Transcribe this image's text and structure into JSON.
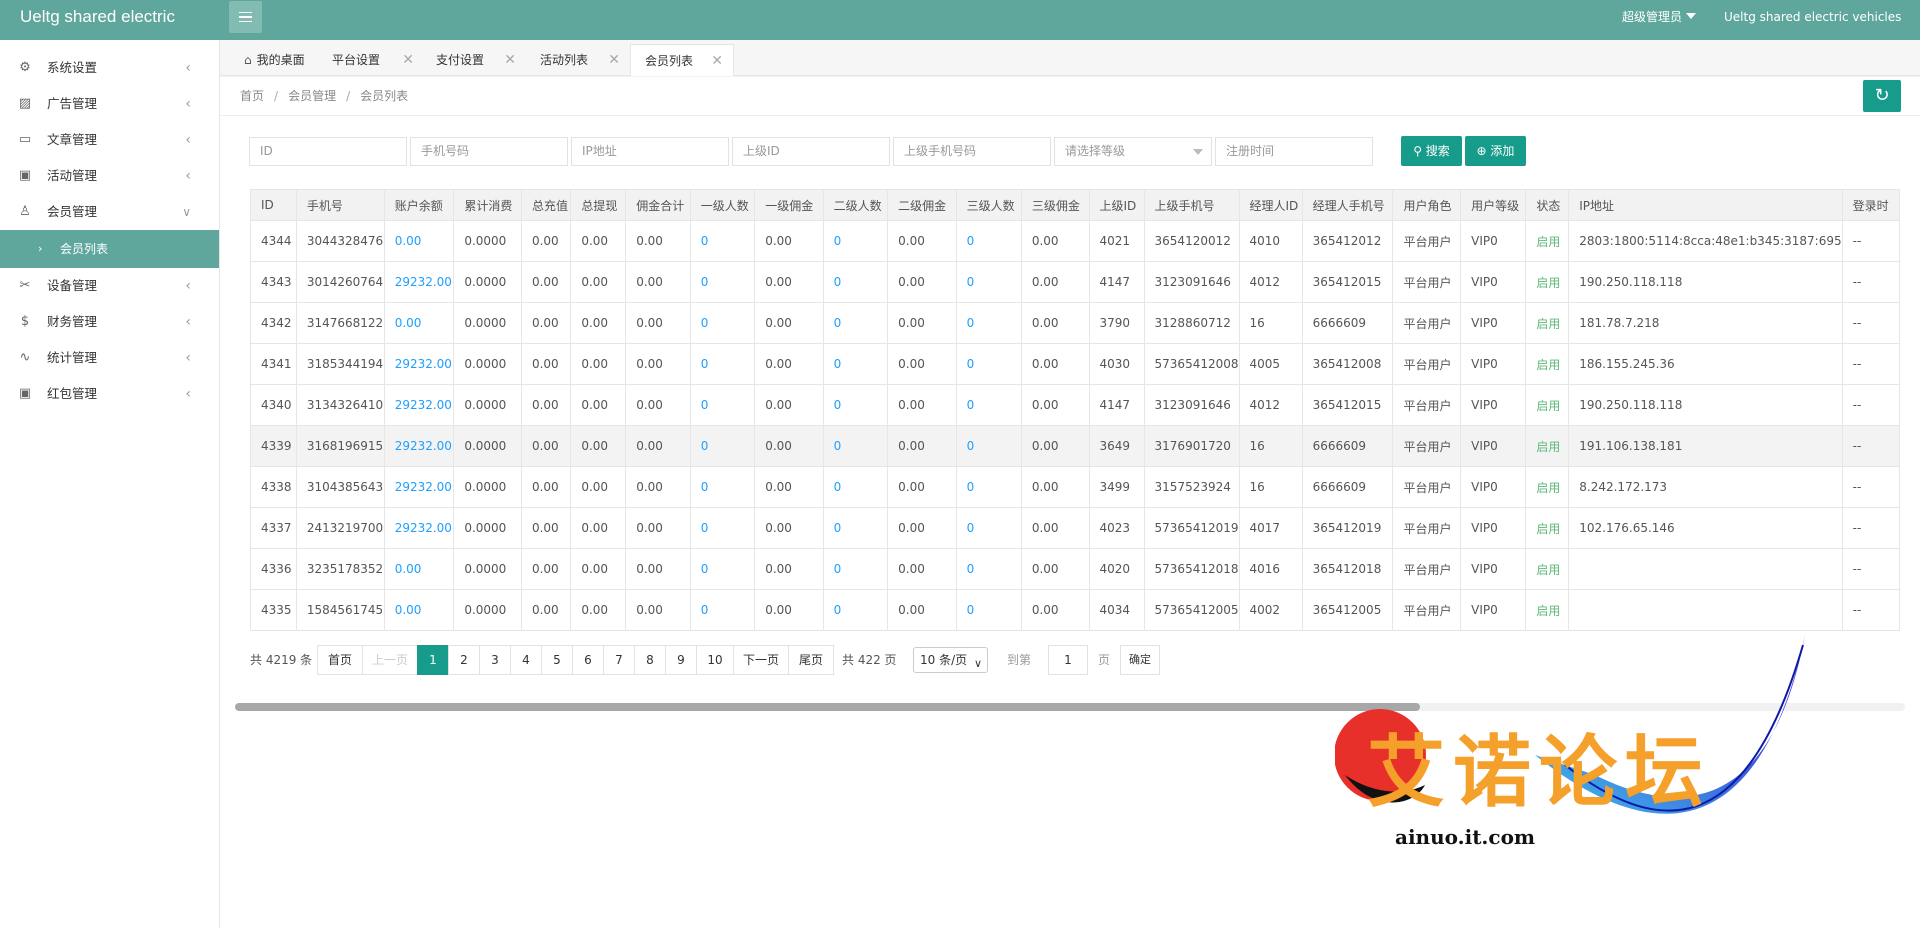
{
  "header": {
    "app_title": "Ueltg shared electric",
    "user_name": "超级管理员",
    "app_right": "Ueltg shared electric vehicles"
  },
  "sidebar": {
    "items": [
      {
        "label": "系统设置",
        "icon": "gear-icon",
        "chev": "‹"
      },
      {
        "label": "广告管理",
        "icon": "image-icon",
        "chev": "‹"
      },
      {
        "label": "文章管理",
        "icon": "book-icon",
        "chev": "‹"
      },
      {
        "label": "活动管理",
        "icon": "gift-icon",
        "chev": "‹"
      },
      {
        "label": "会员管理",
        "icon": "user-icon",
        "chev": "⌄"
      },
      {
        "label": "设备管理",
        "icon": "tools-icon",
        "chev": "‹"
      },
      {
        "label": "财务管理",
        "icon": "dollar-icon",
        "chev": "‹"
      },
      {
        "label": "统计管理",
        "icon": "chart-icon",
        "chev": "‹"
      },
      {
        "label": "红包管理",
        "icon": "gift-icon",
        "chev": "‹"
      }
    ],
    "sub_item": "会员列表"
  },
  "tabs": [
    {
      "label": "我的桌面"
    },
    {
      "label": "平台设置"
    },
    {
      "label": "支付设置"
    },
    {
      "label": "活动列表"
    },
    {
      "label": "会员列表"
    }
  ],
  "breadcrumb": {
    "home": "首页",
    "parent": "会员管理",
    "current": "会员列表"
  },
  "filters": {
    "id": "ID",
    "phone": "手机号码",
    "ip": "IP地址",
    "parent_id": "上级ID",
    "parent_phone": "上级手机号码",
    "level": "请选择等级",
    "reg_time": "注册时间"
  },
  "buttons": {
    "search": "搜索",
    "add": "添加"
  },
  "table": {
    "columns": [
      "ID",
      "手机号",
      "账户余额",
      "累计消费",
      "总充值",
      "总提现",
      "佣金合计",
      "一级人数",
      "一级佣金",
      "二级人数",
      "二级佣金",
      "三级人数",
      "三级佣金",
      "上级ID",
      "上级手机号",
      "经理人ID",
      "经理人手机号",
      "用户角色",
      "用户等级",
      "状态",
      "IP地址",
      "登录时"
    ],
    "rows": [
      [
        "4344",
        "3044328476",
        "0.00",
        "0.0000",
        "0.00",
        "0.00",
        "0.00",
        "0",
        "0.00",
        "0",
        "0.00",
        "0",
        "0.00",
        "4021",
        "3654120012",
        "4010",
        "365412012",
        "平台用户",
        "VIP0",
        "启用",
        "2803:1800:5114:8cca:48e1:b345:3187:695",
        "--"
      ],
      [
        "4343",
        "3014260764",
        "29232.00",
        "0.0000",
        "0.00",
        "0.00",
        "0.00",
        "0",
        "0.00",
        "0",
        "0.00",
        "0",
        "0.00",
        "4147",
        "3123091646",
        "4012",
        "365412015",
        "平台用户",
        "VIP0",
        "启用",
        "190.250.118.118",
        "--"
      ],
      [
        "4342",
        "3147668122",
        "0.00",
        "0.0000",
        "0.00",
        "0.00",
        "0.00",
        "0",
        "0.00",
        "0",
        "0.00",
        "0",
        "0.00",
        "3790",
        "3128860712",
        "16",
        "6666609",
        "平台用户",
        "VIP0",
        "启用",
        "181.78.7.218",
        "--"
      ],
      [
        "4341",
        "3185344194",
        "29232.00",
        "0.0000",
        "0.00",
        "0.00",
        "0.00",
        "0",
        "0.00",
        "0",
        "0.00",
        "0",
        "0.00",
        "4030",
        "57365412008",
        "4005",
        "365412008",
        "平台用户",
        "VIP0",
        "启用",
        "186.155.245.36",
        "--"
      ],
      [
        "4340",
        "3134326410",
        "29232.00",
        "0.0000",
        "0.00",
        "0.00",
        "0.00",
        "0",
        "0.00",
        "0",
        "0.00",
        "0",
        "0.00",
        "4147",
        "3123091646",
        "4012",
        "365412015",
        "平台用户",
        "VIP0",
        "启用",
        "190.250.118.118",
        "--"
      ],
      [
        "4339",
        "3168196915",
        "29232.00",
        "0.0000",
        "0.00",
        "0.00",
        "0.00",
        "0",
        "0.00",
        "0",
        "0.00",
        "0",
        "0.00",
        "3649",
        "3176901720",
        "16",
        "6666609",
        "平台用户",
        "VIP0",
        "启用",
        "191.106.138.181",
        "--"
      ],
      [
        "4338",
        "3104385643",
        "29232.00",
        "0.0000",
        "0.00",
        "0.00",
        "0.00",
        "0",
        "0.00",
        "0",
        "0.00",
        "0",
        "0.00",
        "3499",
        "3157523924",
        "16",
        "6666609",
        "平台用户",
        "VIP0",
        "启用",
        "8.242.172.173",
        "--"
      ],
      [
        "4337",
        "2413219700",
        "29232.00",
        "0.0000",
        "0.00",
        "0.00",
        "0.00",
        "0",
        "0.00",
        "0",
        "0.00",
        "0",
        "0.00",
        "4023",
        "57365412019",
        "4017",
        "365412019",
        "平台用户",
        "VIP0",
        "启用",
        "102.176.65.146",
        "--"
      ],
      [
        "4336",
        "3235178352",
        "0.00",
        "0.0000",
        "0.00",
        "0.00",
        "0.00",
        "0",
        "0.00",
        "0",
        "0.00",
        "0",
        "0.00",
        "4020",
        "57365412018",
        "4016",
        "365412018",
        "平台用户",
        "VIP0",
        "启用",
        "",
        "--"
      ],
      [
        "4335",
        "1584561745",
        "0.00",
        "0.0000",
        "0.00",
        "0.00",
        "0.00",
        "0",
        "0.00",
        "0",
        "0.00",
        "0",
        "0.00",
        "4034",
        "57365412005",
        "4002",
        "365412005",
        "平台用户",
        "VIP0",
        "启用",
        "",
        "--"
      ]
    ],
    "highlight_row": 5
  },
  "pagination": {
    "total": "共 4219 条",
    "first": "首页",
    "prev": "上一页",
    "pages": [
      "1",
      "2",
      "3",
      "4",
      "5",
      "6",
      "7",
      "8",
      "9",
      "10"
    ],
    "current_page": "1",
    "next": "下一页",
    "last": "尾页",
    "total_pages": "共 422 页",
    "per_page": "10 条/页",
    "goto_label": "到第",
    "goto_value": "1",
    "page_suffix": "页",
    "confirm": "确定"
  },
  "watermark": {
    "text": "艾诺论坛",
    "url": "ainuo.it.com"
  },
  "colors": {
    "primary": "#179b8b",
    "header": "#5fa79c",
    "link": "#1e9fff",
    "status_on": "#5fb878"
  }
}
